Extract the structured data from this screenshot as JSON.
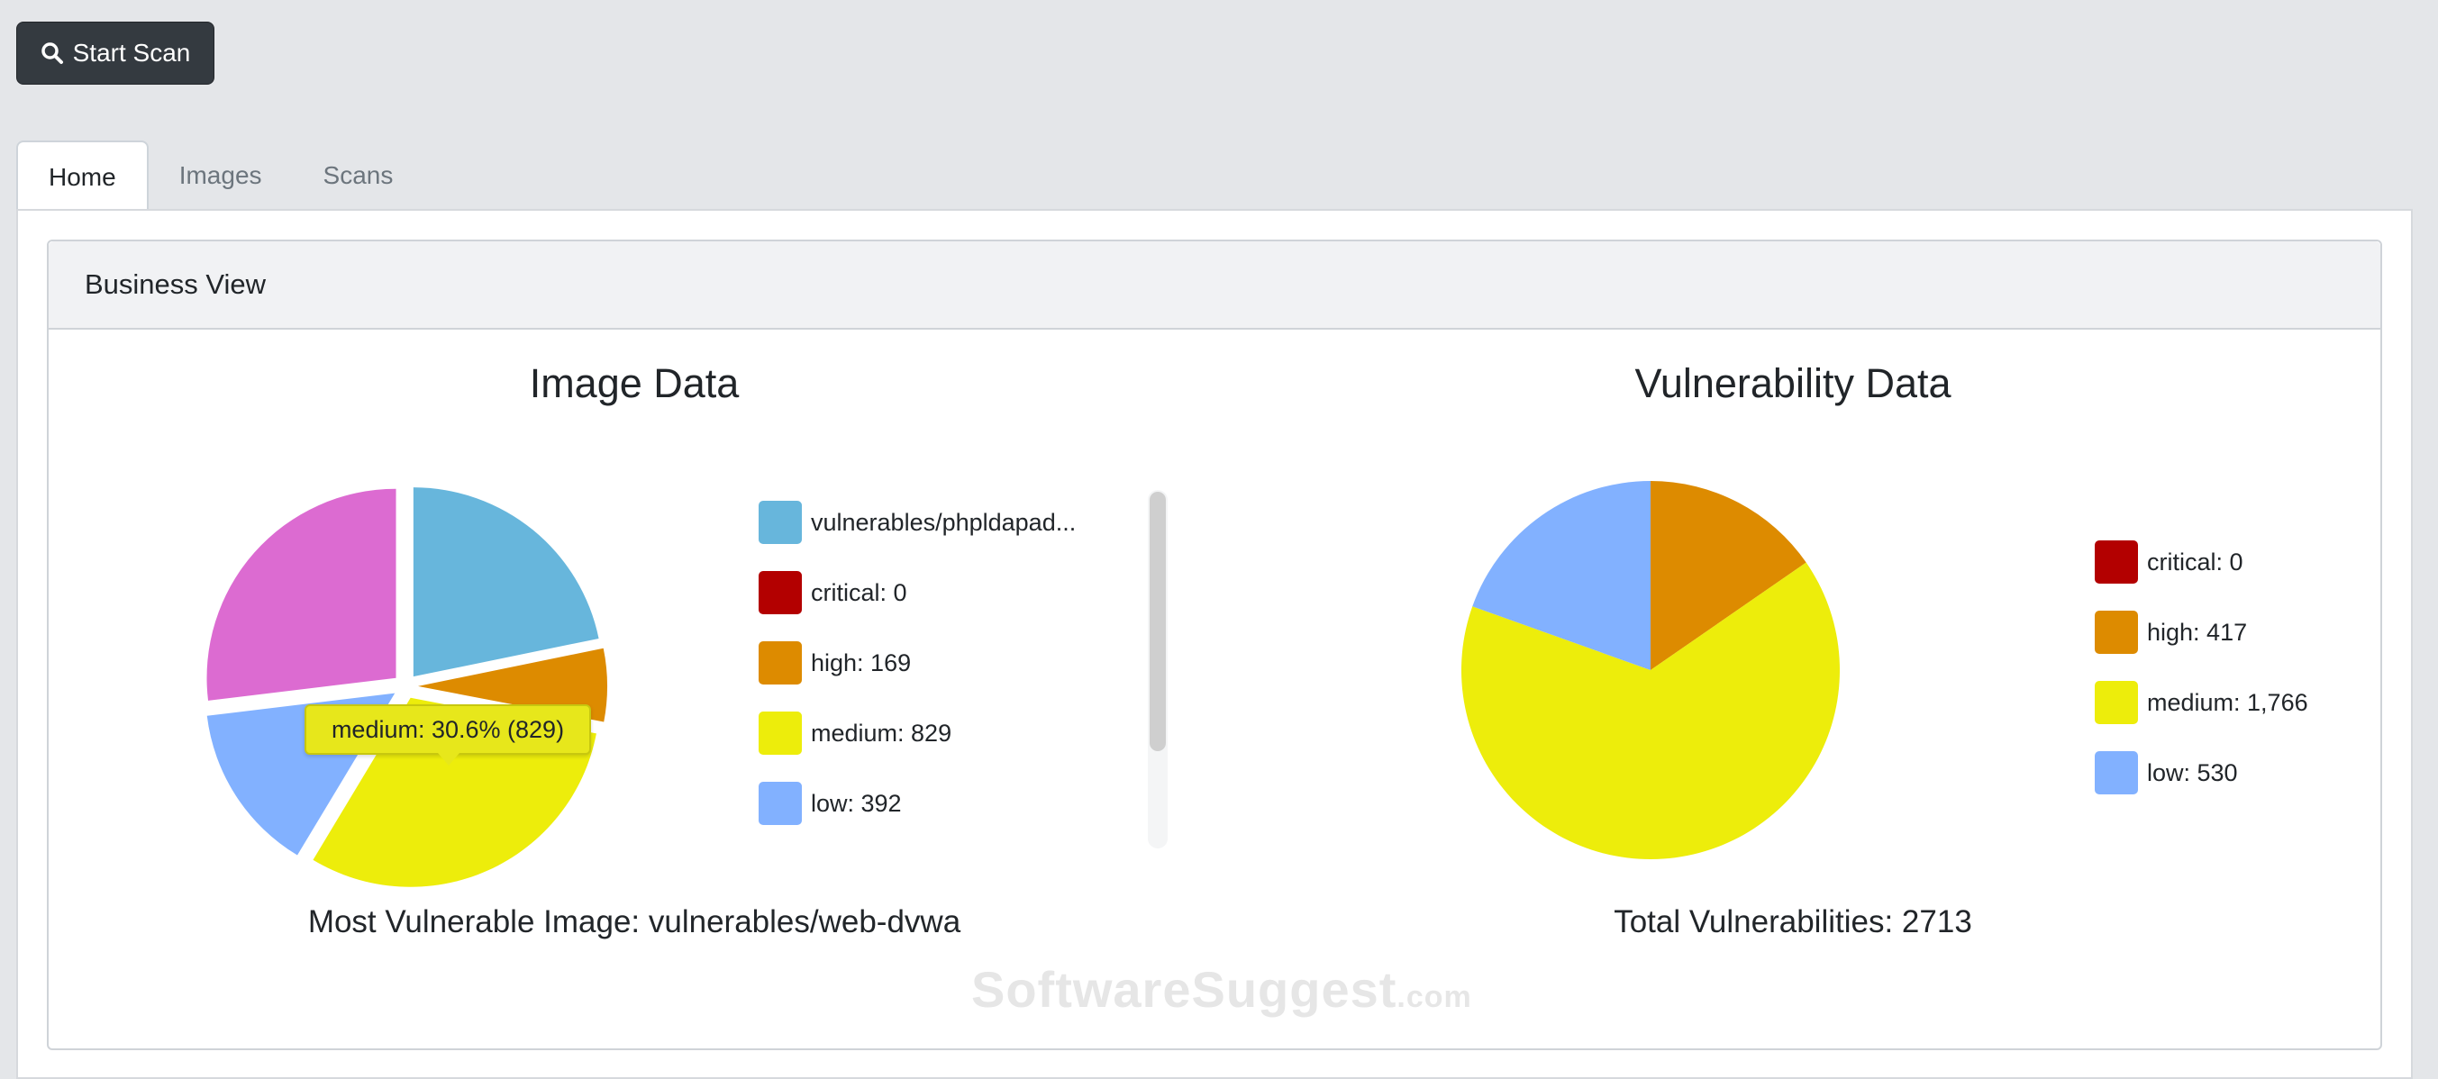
{
  "toolbar": {
    "start_scan_label": "Start Scan",
    "start_scan_icon": "search-icon"
  },
  "tabs": [
    {
      "label": "Home",
      "active": true
    },
    {
      "label": "Images",
      "active": false
    },
    {
      "label": "Scans",
      "active": false
    }
  ],
  "card": {
    "title": "Business View"
  },
  "image_chart": {
    "title": "Image Data",
    "summary": "Most Vulnerable Image: vulnerables/web-dvwa",
    "tooltip": "medium: 30.6% (829)",
    "legend": [
      {
        "label": "vulnerables/phpldapad...",
        "color": "#67b6dc"
      },
      {
        "label": "critical: 0",
        "color": "#b30000"
      },
      {
        "label": "high: 169",
        "color": "#dd8b00"
      },
      {
        "label": "medium: 829",
        "color": "#eded0b"
      },
      {
        "label": "low: 392",
        "color": "#82b1ff"
      }
    ]
  },
  "vuln_chart": {
    "title": "Vulnerability Data",
    "summary": "Total Vulnerabilities: 2713",
    "legend": [
      {
        "label": "critical: 0",
        "color": "#b30000"
      },
      {
        "label": "high: 417",
        "color": "#dd8b00"
      },
      {
        "label": "medium: 1,766",
        "color": "#eded0b"
      },
      {
        "label": "low: 530",
        "color": "#82b1ff"
      }
    ]
  },
  "chart_data": [
    {
      "type": "pie",
      "title": "Image Data",
      "categories": [
        "vulnerables/phpldapad...",
        "critical",
        "high",
        "medium",
        "low",
        ""
      ],
      "values": [
        590,
        0,
        169,
        829,
        392,
        729
      ],
      "colors": [
        "#67b6dc",
        "#b30000",
        "#dd8b00",
        "#eded0b",
        "#82b1ff",
        "#dc6bd1"
      ],
      "highlighted": "medium"
    },
    {
      "type": "pie",
      "title": "Vulnerability Data",
      "categories": [
        "critical",
        "high",
        "medium",
        "low"
      ],
      "values": [
        0,
        417,
        1766,
        530
      ],
      "colors": [
        "#b30000",
        "#dd8b00",
        "#eded0b",
        "#82b1ff"
      ]
    }
  ],
  "watermark": {
    "text": "SoftwareSuggest",
    "tld": ".com"
  }
}
